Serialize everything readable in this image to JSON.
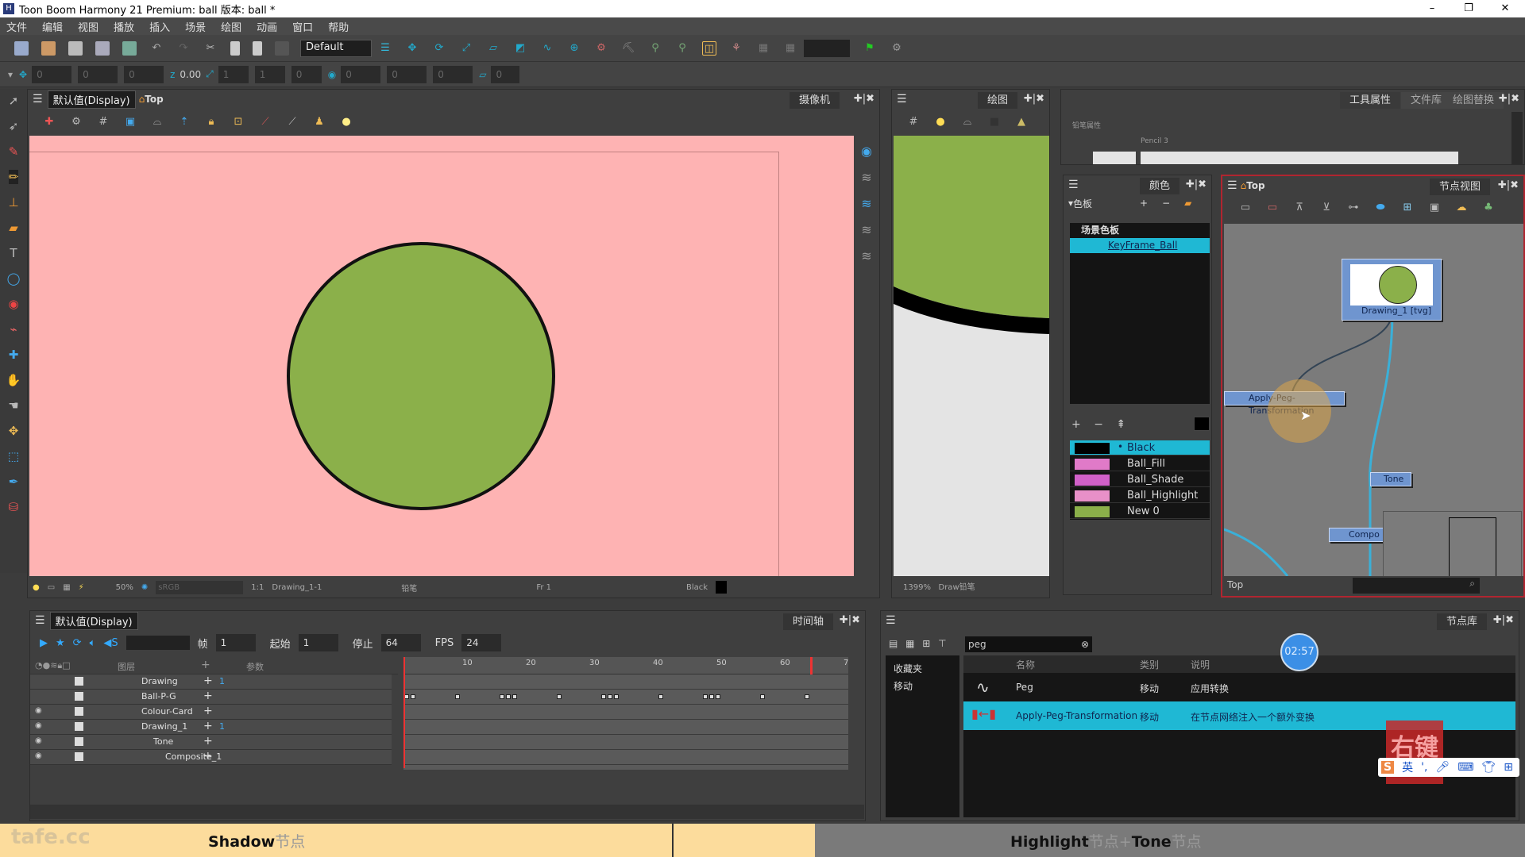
{
  "window": {
    "title": "Toon Boom Harmony 21 Premium: ball 版本: ball *",
    "minimize": "–",
    "maximize": "❐",
    "close": "✕"
  },
  "menu": [
    "文件",
    "编辑",
    "视图",
    "播放",
    "插入",
    "场景",
    "绘图",
    "动画",
    "窗口",
    "帮助"
  ],
  "toolbar": {
    "workspace": "Default",
    "z_value": "0.00",
    "fields": [
      "0",
      "0",
      "0",
      "1",
      "1",
      "0",
      "0",
      "0",
      "0",
      "0",
      "0"
    ]
  },
  "camera": {
    "view_mode": "默认值(Display)",
    "location": "Top",
    "tab": "摄像机",
    "zoom": "50%",
    "color_space": "sRGB",
    "ratio": "1:1",
    "drawing": "Drawing_1-1",
    "tool": "铅笔",
    "frame": "Fr 1",
    "color": "Black"
  },
  "drawing_view": {
    "tab": "绘图",
    "zoom": "1399%",
    "status": "Draw铅笔"
  },
  "tool_properties": {
    "tabs": [
      "工具属性",
      "文件库",
      "绘图替换"
    ],
    "section": "铅笔属性",
    "preset": "Pencil 3"
  },
  "colour": {
    "tab": "颜色",
    "palette_label": "色板",
    "palette_group": "场景色板",
    "palette": "KeyFrame_Ball",
    "swatches": [
      {
        "name": "Black",
        "color": "#000000",
        "selected": true
      },
      {
        "name": "Ball_Fill",
        "color": "#e07ac8"
      },
      {
        "name": "Ball_Shade",
        "color": "#d060c8"
      },
      {
        "name": "Ball_Highlight",
        "color": "#e890c8"
      },
      {
        "name": "New 0",
        "color": "#8bb04a"
      }
    ]
  },
  "node_view": {
    "location": "Top",
    "tab": "节点视图",
    "nodes": {
      "drawing": "Drawing_1 [tvg]",
      "apply_peg": "Apply-Peg-Transformation",
      "tone": "Tone",
      "composite": "Compo"
    },
    "footer": "Top"
  },
  "timeline": {
    "view_mode": "默认值(Display)",
    "tab": "时间轴",
    "frame_label": "帧",
    "frame": "1",
    "start_label": "起始",
    "start": "1",
    "stop_label": "停止",
    "stop": "64",
    "fps_label": "FPS",
    "fps": "24",
    "layers_header": "图层",
    "params_header": "参数",
    "ruler": [
      "10",
      "20",
      "30",
      "40",
      "50",
      "60",
      "7"
    ],
    "layers": [
      {
        "name": "Drawing",
        "param": "1"
      },
      {
        "name": "Ball-P-G",
        "param": ""
      },
      {
        "name": "Colour-Card",
        "param": ""
      },
      {
        "name": "Drawing_1",
        "param": "1"
      },
      {
        "name": "Tone",
        "param": ""
      },
      {
        "name": "Composite_1",
        "param": ""
      }
    ],
    "keyframes": [
      1,
      2,
      9,
      16,
      17,
      18,
      25,
      32,
      33,
      34,
      41,
      48,
      49,
      50,
      57,
      64
    ]
  },
  "node_library": {
    "tab": "节点库",
    "search": "peg",
    "categories": [
      "收藏夹",
      "移动"
    ],
    "columns": [
      "名称",
      "类别",
      "说明"
    ],
    "rows": [
      {
        "name": "Peg",
        "category": "移动",
        "desc": "应用转换"
      },
      {
        "name": "Apply-Peg-Transformation",
        "category": "移动",
        "desc": "在节点网络注入一个额外变换"
      }
    ]
  },
  "overlay": {
    "timer": "02:57",
    "ime": "英",
    "watermark": "tafe.cc",
    "caption_left_bold": "Shadow",
    "caption_left": "节点",
    "caption_right_bold": "Highlight",
    "caption_right_mid": "节点+",
    "caption_right_bold2": "Tone",
    "caption_right": "节点",
    "key_hint": "右键"
  },
  "colors": {
    "canvas": "#feb3b3",
    "ball": "#8bb04a",
    "selection": "#1fb8d4",
    "node": "#6f95cf",
    "caption": "#fcdc9c"
  }
}
